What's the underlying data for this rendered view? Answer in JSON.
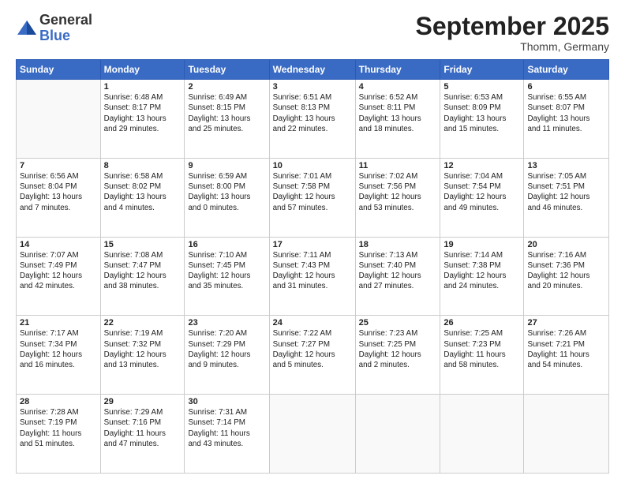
{
  "logo": {
    "general": "General",
    "blue": "Blue"
  },
  "title": "September 2025",
  "subtitle": "Thomm, Germany",
  "days_of_week": [
    "Sunday",
    "Monday",
    "Tuesday",
    "Wednesday",
    "Thursday",
    "Friday",
    "Saturday"
  ],
  "weeks": [
    [
      {
        "day": "",
        "info": ""
      },
      {
        "day": "1",
        "info": "Sunrise: 6:48 AM\nSunset: 8:17 PM\nDaylight: 13 hours\nand 29 minutes."
      },
      {
        "day": "2",
        "info": "Sunrise: 6:49 AM\nSunset: 8:15 PM\nDaylight: 13 hours\nand 25 minutes."
      },
      {
        "day": "3",
        "info": "Sunrise: 6:51 AM\nSunset: 8:13 PM\nDaylight: 13 hours\nand 22 minutes."
      },
      {
        "day": "4",
        "info": "Sunrise: 6:52 AM\nSunset: 8:11 PM\nDaylight: 13 hours\nand 18 minutes."
      },
      {
        "day": "5",
        "info": "Sunrise: 6:53 AM\nSunset: 8:09 PM\nDaylight: 13 hours\nand 15 minutes."
      },
      {
        "day": "6",
        "info": "Sunrise: 6:55 AM\nSunset: 8:07 PM\nDaylight: 13 hours\nand 11 minutes."
      }
    ],
    [
      {
        "day": "7",
        "info": "Sunrise: 6:56 AM\nSunset: 8:04 PM\nDaylight: 13 hours\nand 7 minutes."
      },
      {
        "day": "8",
        "info": "Sunrise: 6:58 AM\nSunset: 8:02 PM\nDaylight: 13 hours\nand 4 minutes."
      },
      {
        "day": "9",
        "info": "Sunrise: 6:59 AM\nSunset: 8:00 PM\nDaylight: 13 hours\nand 0 minutes."
      },
      {
        "day": "10",
        "info": "Sunrise: 7:01 AM\nSunset: 7:58 PM\nDaylight: 12 hours\nand 57 minutes."
      },
      {
        "day": "11",
        "info": "Sunrise: 7:02 AM\nSunset: 7:56 PM\nDaylight: 12 hours\nand 53 minutes."
      },
      {
        "day": "12",
        "info": "Sunrise: 7:04 AM\nSunset: 7:54 PM\nDaylight: 12 hours\nand 49 minutes."
      },
      {
        "day": "13",
        "info": "Sunrise: 7:05 AM\nSunset: 7:51 PM\nDaylight: 12 hours\nand 46 minutes."
      }
    ],
    [
      {
        "day": "14",
        "info": "Sunrise: 7:07 AM\nSunset: 7:49 PM\nDaylight: 12 hours\nand 42 minutes."
      },
      {
        "day": "15",
        "info": "Sunrise: 7:08 AM\nSunset: 7:47 PM\nDaylight: 12 hours\nand 38 minutes."
      },
      {
        "day": "16",
        "info": "Sunrise: 7:10 AM\nSunset: 7:45 PM\nDaylight: 12 hours\nand 35 minutes."
      },
      {
        "day": "17",
        "info": "Sunrise: 7:11 AM\nSunset: 7:43 PM\nDaylight: 12 hours\nand 31 minutes."
      },
      {
        "day": "18",
        "info": "Sunrise: 7:13 AM\nSunset: 7:40 PM\nDaylight: 12 hours\nand 27 minutes."
      },
      {
        "day": "19",
        "info": "Sunrise: 7:14 AM\nSunset: 7:38 PM\nDaylight: 12 hours\nand 24 minutes."
      },
      {
        "day": "20",
        "info": "Sunrise: 7:16 AM\nSunset: 7:36 PM\nDaylight: 12 hours\nand 20 minutes."
      }
    ],
    [
      {
        "day": "21",
        "info": "Sunrise: 7:17 AM\nSunset: 7:34 PM\nDaylight: 12 hours\nand 16 minutes."
      },
      {
        "day": "22",
        "info": "Sunrise: 7:19 AM\nSunset: 7:32 PM\nDaylight: 12 hours\nand 13 minutes."
      },
      {
        "day": "23",
        "info": "Sunrise: 7:20 AM\nSunset: 7:29 PM\nDaylight: 12 hours\nand 9 minutes."
      },
      {
        "day": "24",
        "info": "Sunrise: 7:22 AM\nSunset: 7:27 PM\nDaylight: 12 hours\nand 5 minutes."
      },
      {
        "day": "25",
        "info": "Sunrise: 7:23 AM\nSunset: 7:25 PM\nDaylight: 12 hours\nand 2 minutes."
      },
      {
        "day": "26",
        "info": "Sunrise: 7:25 AM\nSunset: 7:23 PM\nDaylight: 11 hours\nand 58 minutes."
      },
      {
        "day": "27",
        "info": "Sunrise: 7:26 AM\nSunset: 7:21 PM\nDaylight: 11 hours\nand 54 minutes."
      }
    ],
    [
      {
        "day": "28",
        "info": "Sunrise: 7:28 AM\nSunset: 7:19 PM\nDaylight: 11 hours\nand 51 minutes."
      },
      {
        "day": "29",
        "info": "Sunrise: 7:29 AM\nSunset: 7:16 PM\nDaylight: 11 hours\nand 47 minutes."
      },
      {
        "day": "30",
        "info": "Sunrise: 7:31 AM\nSunset: 7:14 PM\nDaylight: 11 hours\nand 43 minutes."
      },
      {
        "day": "",
        "info": ""
      },
      {
        "day": "",
        "info": ""
      },
      {
        "day": "",
        "info": ""
      },
      {
        "day": "",
        "info": ""
      }
    ]
  ]
}
